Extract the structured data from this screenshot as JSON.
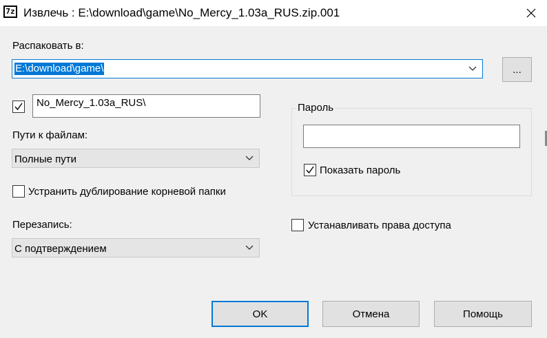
{
  "window": {
    "icon_text": "7z",
    "title": "Извлечь : E:\\download\\game\\No_Mercy_1.03a_RUS.zip.001"
  },
  "extract_to": {
    "label": "Распаковать в:",
    "value": "E:\\download\\game\\",
    "browse_label": "..."
  },
  "subfolder": {
    "checked": true,
    "value": "No_Mercy_1.03a_RUS\\"
  },
  "path_mode": {
    "label": "Пути к файлам:",
    "selected": "Полные пути"
  },
  "eliminate_duplication": {
    "label": "Устранить дублирование корневой папки",
    "checked": false
  },
  "overwrite": {
    "label": "Перезапись:",
    "selected": "С подтверждением"
  },
  "password": {
    "group_label": "Пароль",
    "value": "",
    "show_label": "Показать пароль",
    "show_checked": true
  },
  "set_access_rights": {
    "label": "Устанавливать права доступа",
    "checked": false
  },
  "buttons": {
    "ok": "OK",
    "cancel": "Отмена",
    "help": "Помощь"
  }
}
